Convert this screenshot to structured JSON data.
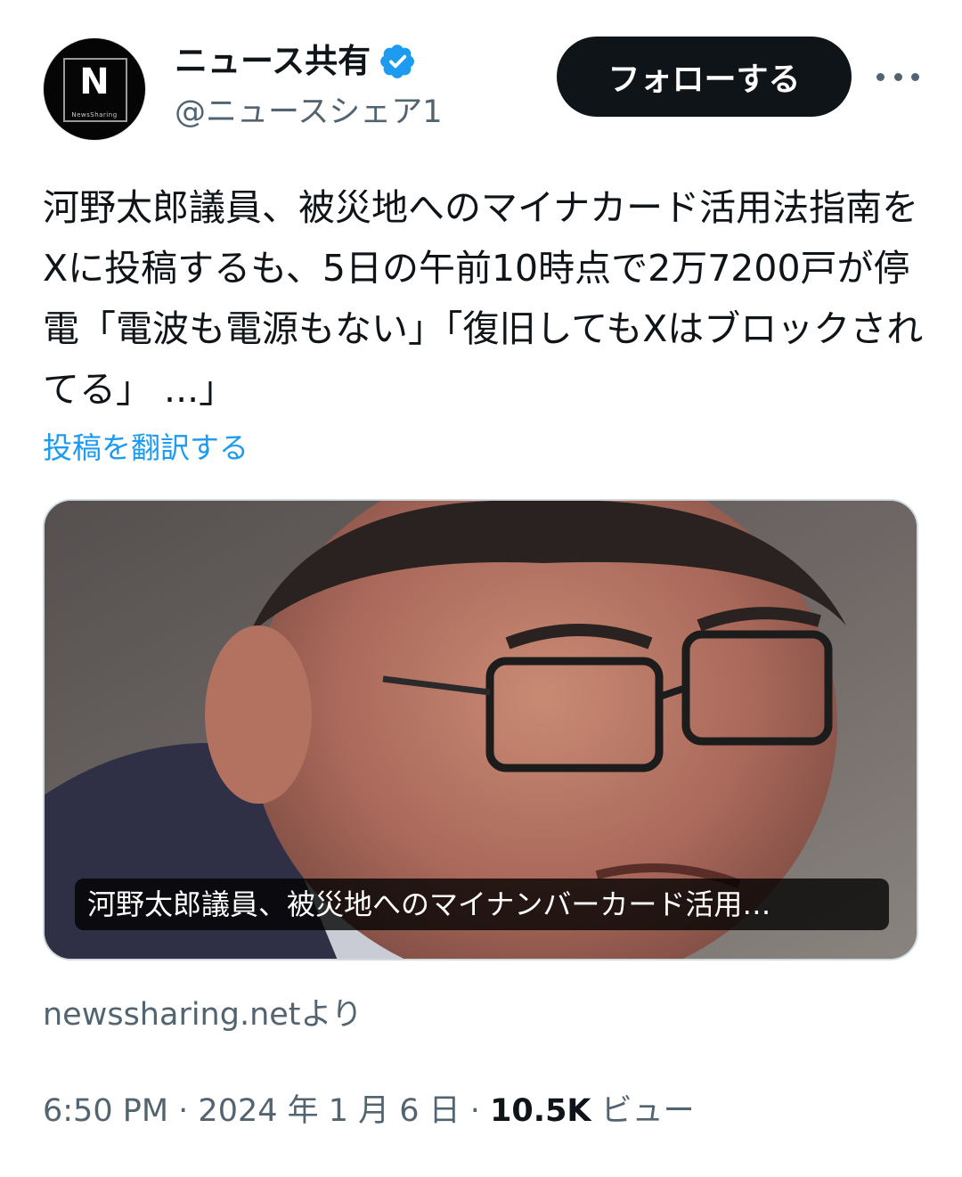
{
  "account": {
    "display_name": "ニュース共有",
    "handle": "@ニュースシェア1",
    "avatar_letter": "N",
    "avatar_text": "NewsSharing",
    "verified": true,
    "verified_icon": "verified-badge-icon",
    "verified_color": "#1d9bf0"
  },
  "actions": {
    "follow_label": "フォローする",
    "more_icon": "more-horizontal-icon"
  },
  "tweet": {
    "text": "河野太郎議員、被災地へのマイナカード活用法指南をXに投稿するも、5日の午前10時点で2万7200戸が停電「電波も電源もない」「復旧してもXはブロックされてる」 ...」",
    "translate_label": "投稿を翻訳する"
  },
  "media": {
    "caption": "河野太郎議員、被災地へのマイナンバーカード活用…"
  },
  "source": {
    "label": "newssharing.netより"
  },
  "meta": {
    "time": "6:50 PM",
    "sep1": " · ",
    "date": "2024 年 1 月 6 日",
    "sep2": " · ",
    "views_count": "10.5K",
    "views_label": " ビュー"
  },
  "colors": {
    "link": "#1d9bf0",
    "secondary_text": "#536471",
    "primary_text": "#0f1419"
  }
}
